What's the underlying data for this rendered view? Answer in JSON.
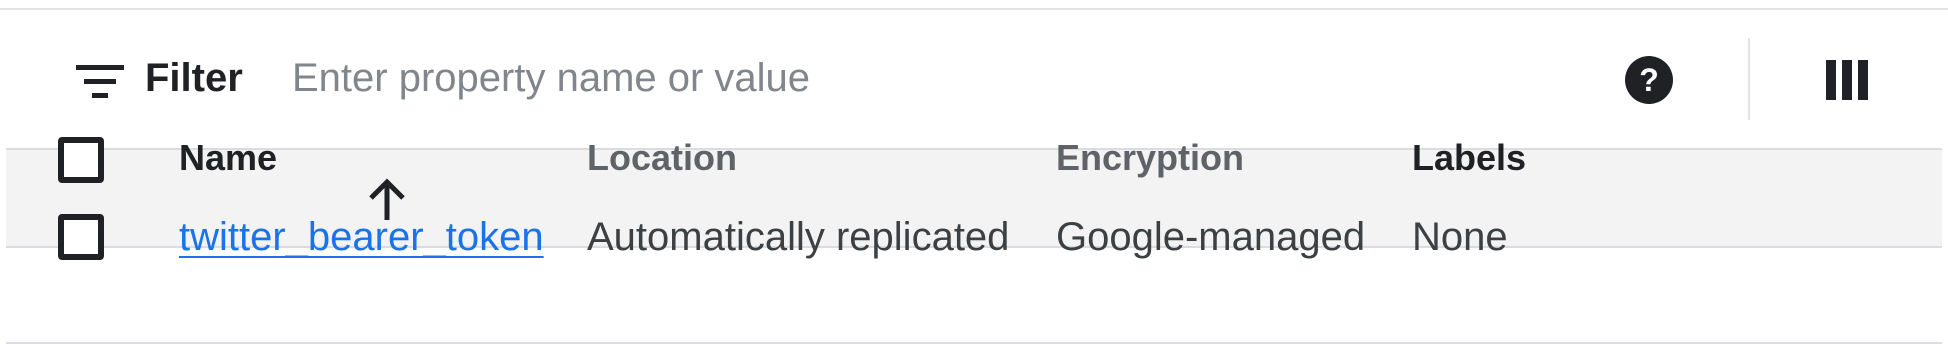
{
  "filter_bar": {
    "label": "Filter",
    "placeholder": "Enter property name or value",
    "value": "",
    "icons": {
      "filter": "filter-lines-icon",
      "help": "help-circle-icon",
      "columns": "column-display-icon"
    }
  },
  "table": {
    "columns": [
      {
        "key": "select",
        "label": ""
      },
      {
        "key": "name",
        "label": "Name",
        "sort": "ascending",
        "sort_icon": "arrow-up-icon"
      },
      {
        "key": "location",
        "label": "Location"
      },
      {
        "key": "encryption",
        "label": "Encryption"
      },
      {
        "key": "labels",
        "label": "Labels"
      }
    ],
    "rows": [
      {
        "selected": false,
        "name": "twitter_bearer_token",
        "location": "Automatically replicated",
        "encryption": "Google-managed",
        "labels": "None"
      }
    ]
  },
  "colors": {
    "link": "#1a73e8",
    "header_bg": "#f3f3f3",
    "border": "#dadce0",
    "text_primary": "#202124",
    "text_secondary": "#5f6368"
  }
}
